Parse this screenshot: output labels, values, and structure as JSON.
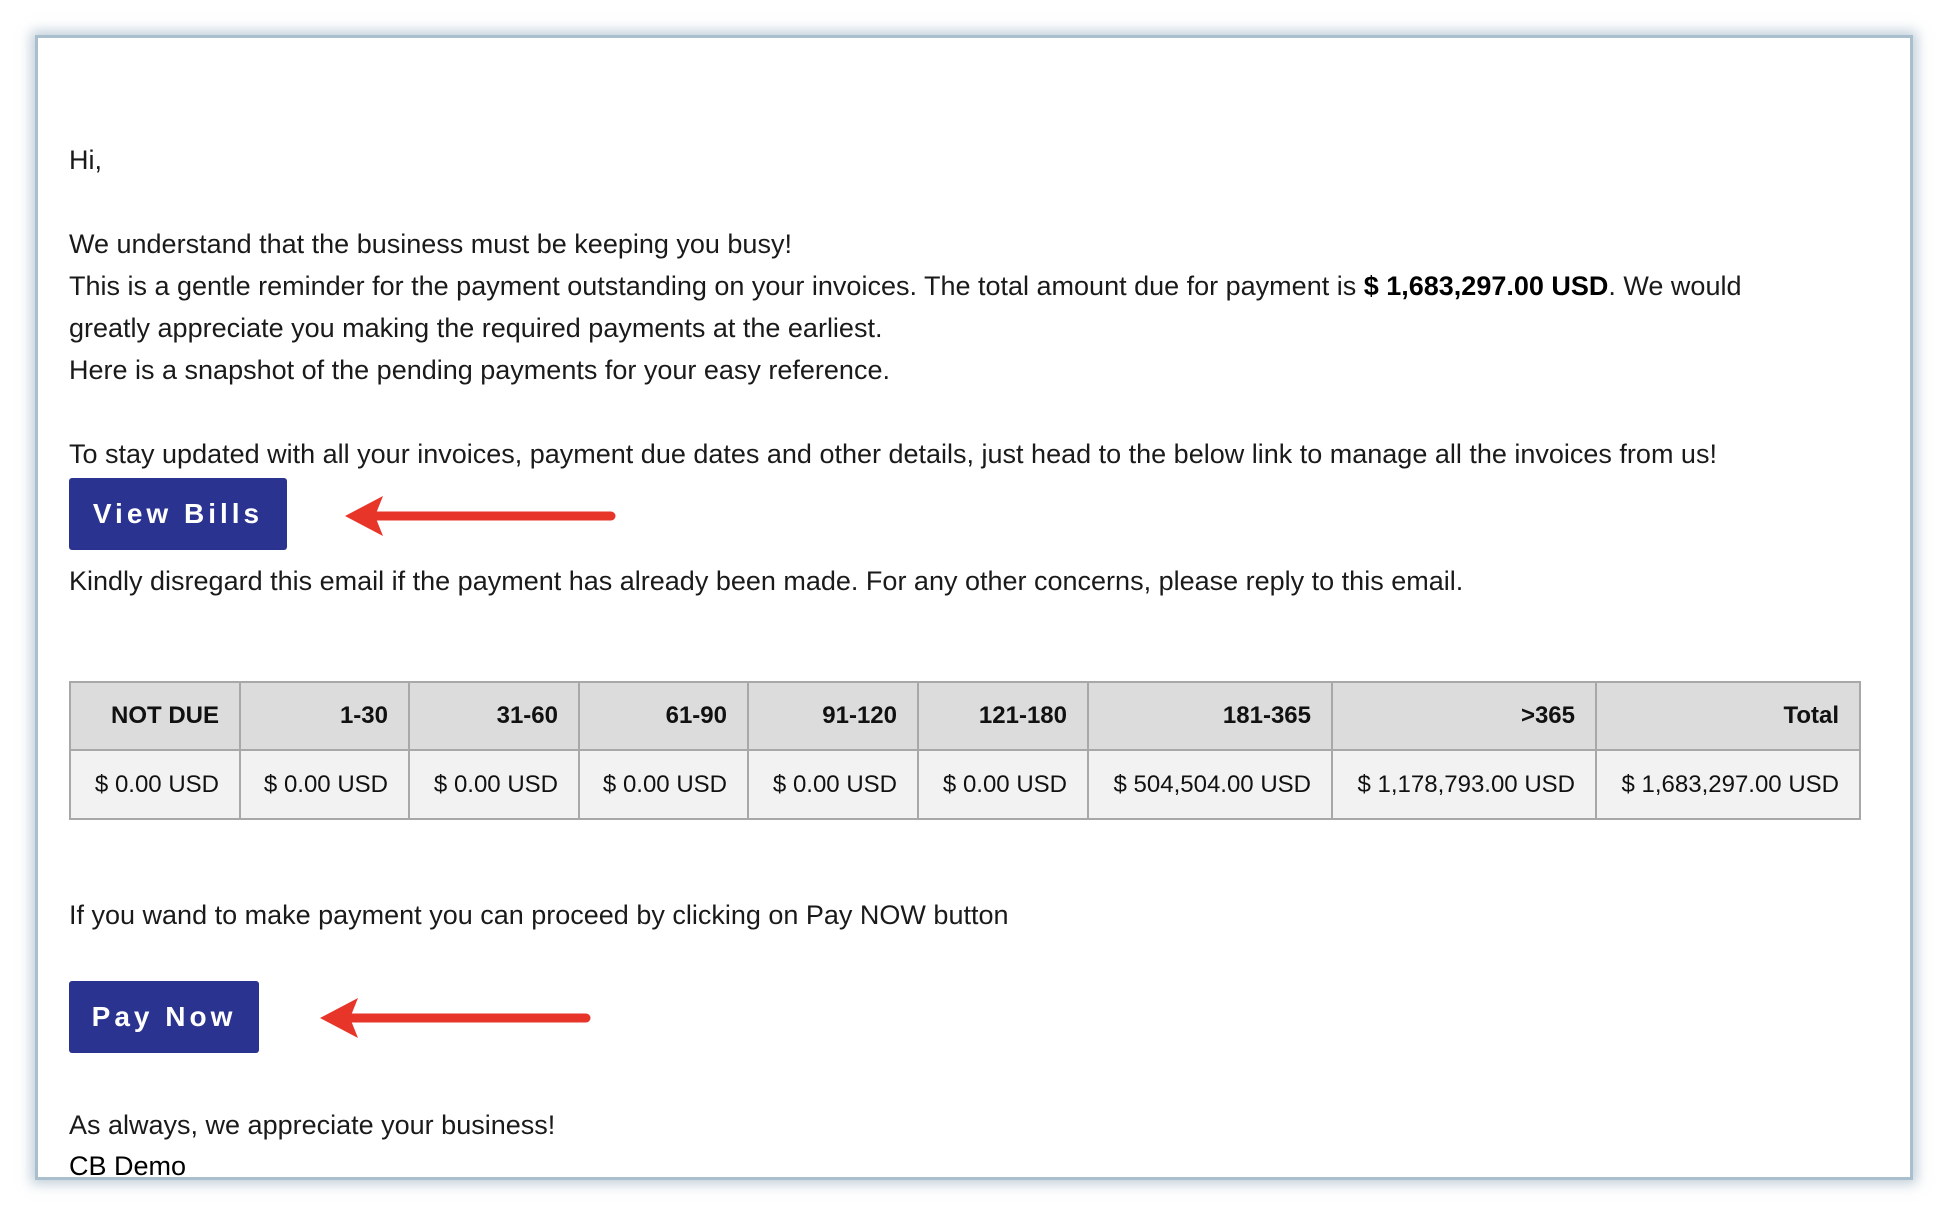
{
  "email": {
    "greeting": "Hi,",
    "line1": "We understand that the business must be keeping you busy!",
    "line2_prefix": "This is a gentle reminder for the payment outstanding on your invoices. The total amount due for payment is ",
    "line2_amount": "$ 1,683,297.00 USD",
    "line2_suffix": ". We would",
    "line3": "greatly appreciate you making the required payments at the earliest.",
    "line4": "Here is a snapshot of the pending payments for your easy reference.",
    "line5": "To stay updated with all your invoices, payment due dates and other details, just head to the below link to manage all the invoices from us!",
    "view_bills_label": "View Bills",
    "line6": "Kindly disregard this email if the payment has already been made. For any other concerns, please reply to this email.",
    "line7": "If you wand to make payment you can proceed by clicking on Pay NOW button",
    "pay_now_label": "Pay Now",
    "closing": "As always, we appreciate your business!",
    "signature": "CB Demo"
  },
  "aging_table": {
    "headers": [
      "NOT DUE",
      "1-30",
      "31-60",
      "61-90",
      "91-120",
      "121-180",
      "181-365",
      ">365",
      "Total"
    ],
    "values": [
      "$ 0.00 USD",
      "$ 0.00 USD",
      "$ 0.00 USD",
      "$ 0.00 USD",
      "$ 0.00 USD",
      "$ 0.00 USD",
      "$ 504,504.00 USD",
      "$ 1,178,793.00 USD",
      "$ 1,683,297.00 USD"
    ]
  },
  "colors": {
    "button_bg": "#2b3390",
    "arrow": "#e8352a",
    "frame_border": "#a9bfcd"
  }
}
